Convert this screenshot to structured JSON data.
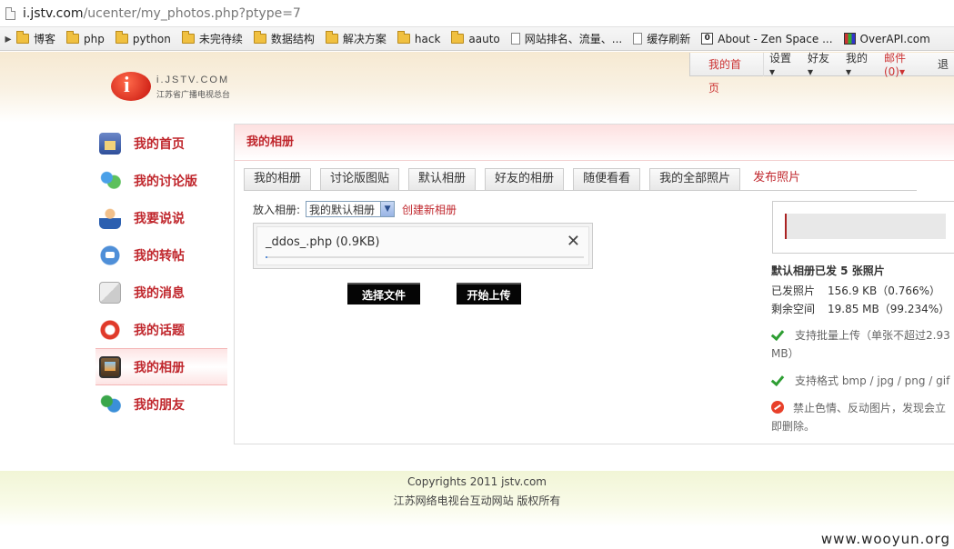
{
  "browser": {
    "url_host": "i.jstv.com",
    "url_rest": "/ucenter/my_photos.php?ptype=7",
    "bookmarks": [
      {
        "type": "folder",
        "label": "博客"
      },
      {
        "type": "folder",
        "label": "php"
      },
      {
        "type": "folder",
        "label": "python"
      },
      {
        "type": "folder",
        "label": "未完待续"
      },
      {
        "type": "folder",
        "label": "数据结构"
      },
      {
        "type": "folder",
        "label": "解决方案"
      },
      {
        "type": "folder",
        "label": "hack"
      },
      {
        "type": "folder",
        "label": "aauto"
      },
      {
        "type": "doc",
        "label": "网站排名、流量、..."
      },
      {
        "type": "doc",
        "label": "缓存刷新"
      },
      {
        "type": "boxi",
        "label": "About - Zen Space ..."
      },
      {
        "type": "over",
        "label": "OverAPI.com"
      }
    ]
  },
  "logo": {
    "mark": "i",
    "line1": "i.JSTV.COM",
    "line2": "江苏省广播电视总台"
  },
  "topnav": {
    "home": "我的首页",
    "settings": "设置▾",
    "friends": "好友▾",
    "mine": "我的▾",
    "mail": "邮件(0)▾",
    "logout": "退"
  },
  "sidebar": {
    "items": [
      {
        "label": "我的首页",
        "icon": "home-icon"
      },
      {
        "label": "我的讨论版",
        "icon": "users-icon"
      },
      {
        "label": "我要说说",
        "icon": "user-icon"
      },
      {
        "label": "我的转帖",
        "icon": "repost-icon"
      },
      {
        "label": "我的消息",
        "icon": "message-icon"
      },
      {
        "label": "我的话题",
        "icon": "lifebuoy-icon"
      },
      {
        "label": "我的相册",
        "icon": "photo-icon"
      },
      {
        "label": "我的朋友",
        "icon": "friends-icon"
      }
    ]
  },
  "main": {
    "title": "我的相册",
    "tabs": [
      "我的相册",
      "讨论版图贴",
      "默认相册",
      "好友的相册",
      "随便看看",
      "我的全部照片"
    ],
    "publish_tab": "发布照片",
    "album_label": "放入相册:",
    "album_selected": "我的默认相册",
    "create_album": "创建新相册",
    "file": {
      "name": "_ddos_.php (0.9KB)",
      "close": "✕",
      "progress": 0.0
    },
    "choose_button": "选择文件",
    "start_button": "开始上传"
  },
  "stats": {
    "title": "默认相册已发 5 张照片",
    "sent_label": "已发照片",
    "sent_value": "156.9 KB（0.766%）",
    "free_label": "剩余空间",
    "free_value": "19.85 MB（99.234%）",
    "note1": "支持批量上传（单张不超过2.93 MB）",
    "note2": "支持格式 bmp / jpg / png / gif",
    "note3": "禁止色情、反动图片，发现会立即删除。"
  },
  "footer": {
    "line1": "Copyrights 2011 jstv.com",
    "line2": "江苏网络电视台互动网站 版权所有"
  },
  "watermark": "www.wooyun.org",
  "colors": {
    "accent_red": "#c0272d",
    "button_black": "#050505"
  }
}
